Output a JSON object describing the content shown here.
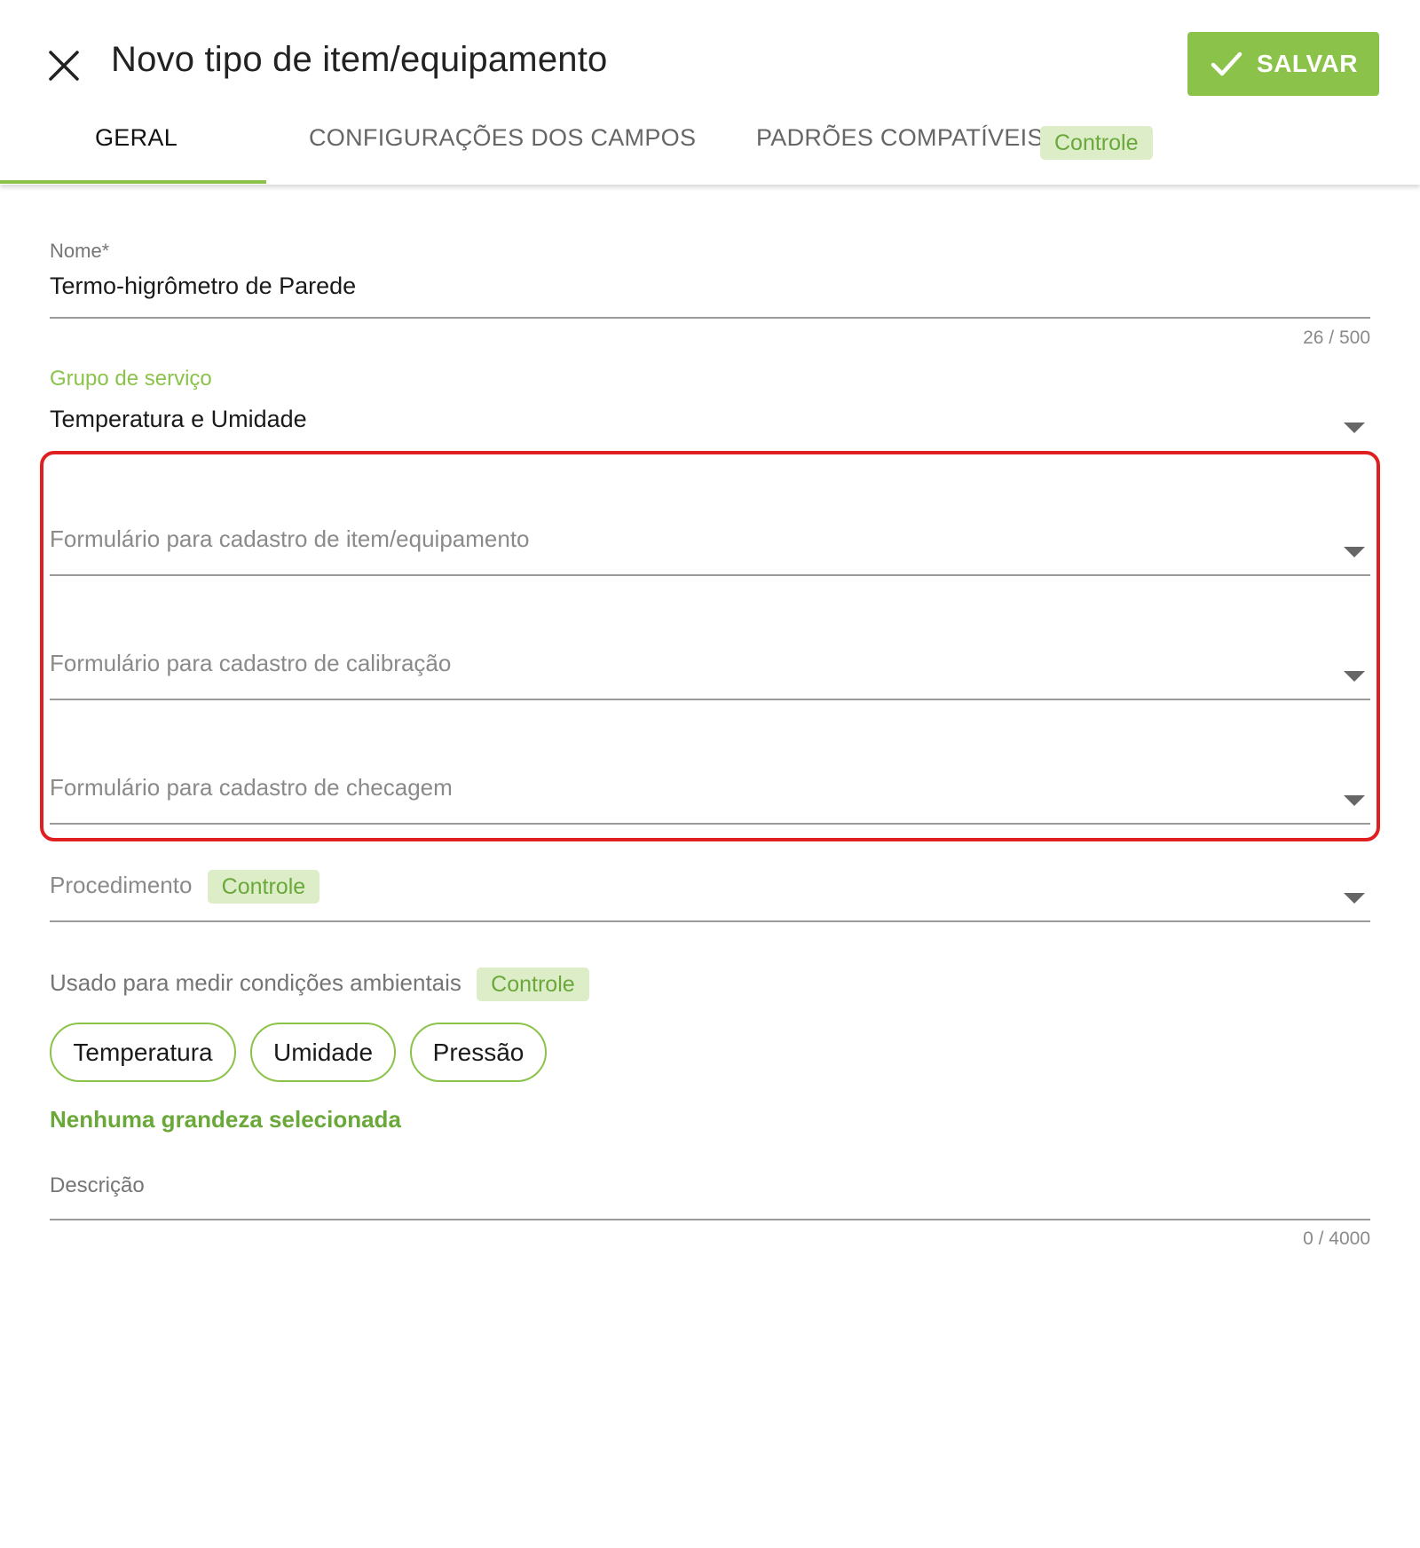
{
  "header": {
    "title": "Novo tipo de item/equipamento",
    "save_label": "SALVAR"
  },
  "tabs": [
    {
      "label": "GERAL",
      "active": true
    },
    {
      "label": "CONFIGURAÇÕES DOS CAMPOS",
      "active": false
    },
    {
      "label": "PADRÕES COMPATÍVEIS",
      "active": false,
      "tag": "Controle"
    }
  ],
  "form": {
    "nome": {
      "label": "Nome*",
      "value": "Termo-higrômetro de Parede",
      "counter": "26 / 500"
    },
    "grupo": {
      "label": "Grupo de serviço",
      "value": "Temperatura e Umidade"
    },
    "formulario_item": {
      "placeholder": "Formulário para cadastro de item/equipamento"
    },
    "formulario_calibracao": {
      "placeholder": "Formulário para cadastro de calibração"
    },
    "formulario_checagem": {
      "placeholder": "Formulário para cadastro de checagem"
    },
    "procedimento": {
      "placeholder": "Procedimento",
      "tag": "Controle"
    },
    "condicoes": {
      "label": "Usado para medir condições ambientais",
      "tag": "Controle",
      "chips": [
        "Temperatura",
        "Umidade",
        "Pressão"
      ],
      "hint": "Nenhuma grandeza selecionada"
    },
    "descricao": {
      "label": "Descrição",
      "counter": "0 / 4000"
    }
  },
  "colors": {
    "accent": "#8bc34a",
    "accent_text": "#6aa83a",
    "tag_bg": "#dcedc8",
    "highlight": "#e02020"
  },
  "icons": {
    "close": "close-icon",
    "save": "check-icon",
    "dropdown": "caret-down-icon"
  }
}
